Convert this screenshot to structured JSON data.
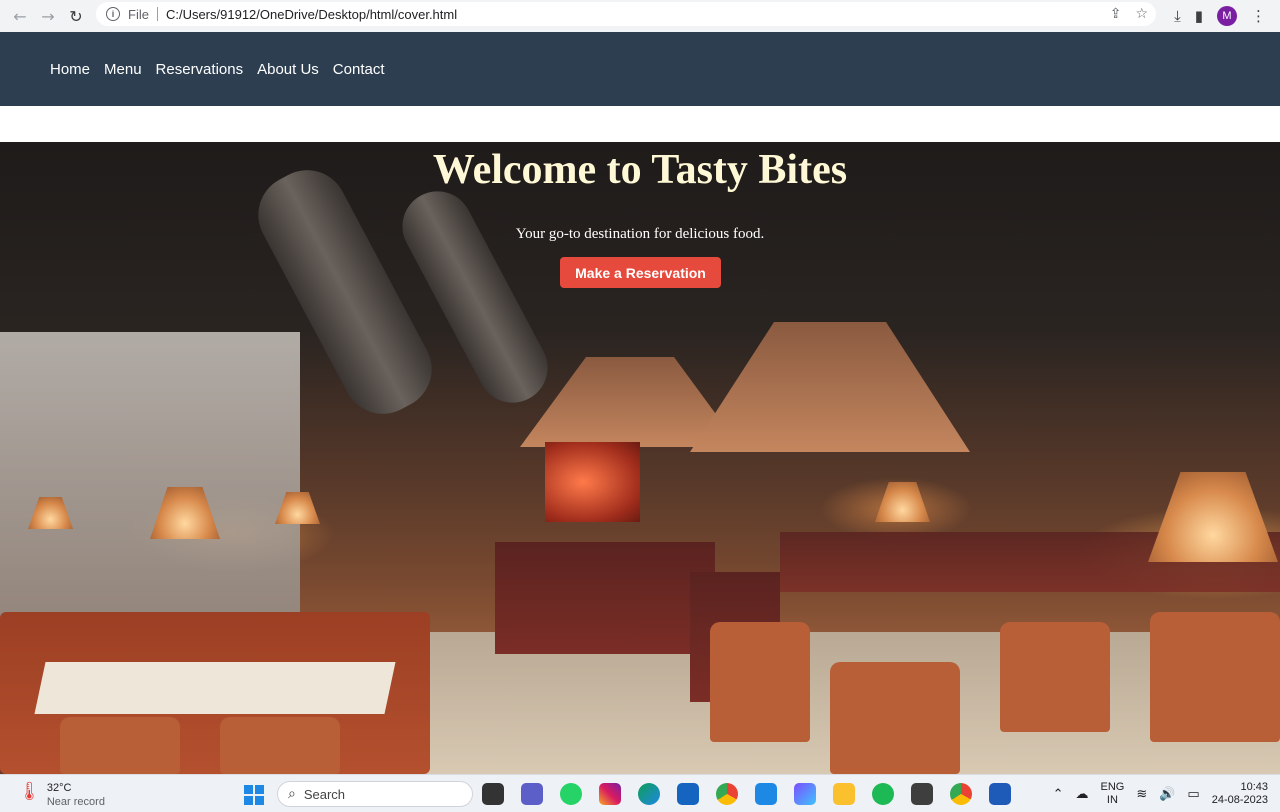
{
  "browser": {
    "scheme_label": "File",
    "url": "C:/Users/91912/OneDrive/Desktop/html/cover.html",
    "profile_initial": "M"
  },
  "site_nav": {
    "items": [
      "Home",
      "Menu",
      "Reservations",
      "About Us",
      "Contact"
    ]
  },
  "hero": {
    "title": "Welcome to Tasty Bites",
    "subtitle": "Your go-to destination for delicious food.",
    "cta_label": "Make a Reservation"
  },
  "taskbar": {
    "weather_temp": "32°C",
    "weather_desc": "Near record",
    "search_placeholder": "Search",
    "lang_top": "ENG",
    "lang_bottom": "IN",
    "time": "10:43",
    "date": "24-08-2023"
  },
  "colors": {
    "nav_bg": "#2c3e50",
    "cta_bg": "#e64a3c",
    "title_color": "#fff8d6"
  }
}
